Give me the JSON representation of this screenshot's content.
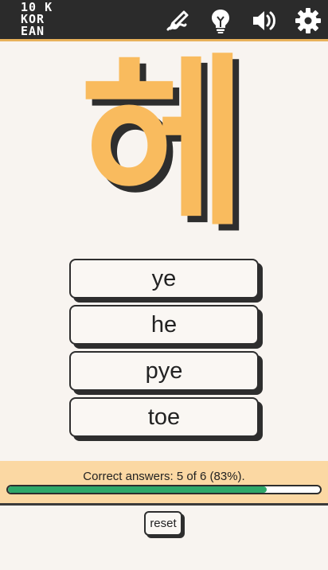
{
  "header": {
    "logo_lines": [
      "10 K",
      "KOR",
      "EAN"
    ],
    "icons": [
      "writing-icon",
      "lightbulb-icon",
      "speaker-icon",
      "gear-icon"
    ]
  },
  "question": {
    "character": "헤"
  },
  "answers": [
    {
      "label": "ye"
    },
    {
      "label": "he"
    },
    {
      "label": "pye"
    },
    {
      "label": "toe"
    }
  ],
  "progress": {
    "text": "Correct answers: 5 of 6 (83%).",
    "fraction": 0.83
  },
  "reset_label": "reset",
  "colors": {
    "accent": "#f9bb5e",
    "header_bg": "#2b2b2b",
    "progress_panel": "#fbd8a3",
    "progress_fill": "#2ea86a"
  }
}
